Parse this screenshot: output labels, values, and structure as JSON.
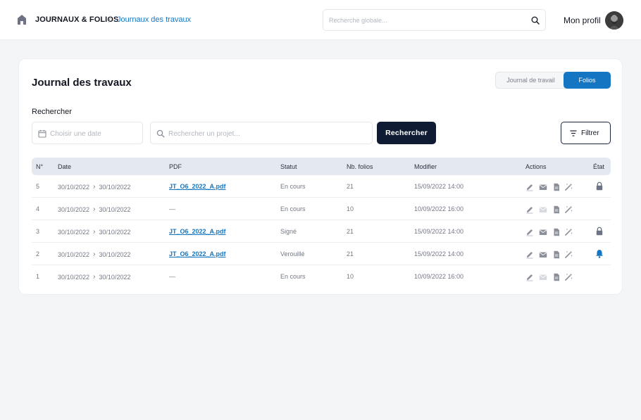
{
  "header": {
    "breadcrumb_root": "JOURNAUX  & FOLIOS",
    "breadcrumb_sep": "/",
    "breadcrumb_current": "Journaux des travaux",
    "search_placeholder": "Recherche globale...",
    "profile_label": "Mon profil"
  },
  "page": {
    "title": "Journal des travaux",
    "tabs": [
      {
        "label": "Journal de travail",
        "active": false
      },
      {
        "label": "Folios",
        "active": true
      }
    ]
  },
  "search": {
    "label": "Rechercher",
    "date_placeholder": "Choisir une date",
    "project_placeholder": "Rechercher un projet...",
    "search_button": "Rechercher",
    "filter_button": "Filtrer"
  },
  "table": {
    "columns": [
      "N°",
      "Date",
      "PDF",
      "Statut",
      "Nb. folios",
      "Modifier",
      "Actions",
      "État"
    ],
    "rows": [
      {
        "no": "5",
        "date_from": "30/10/2022",
        "date_to": "30/10/2022",
        "pdf": "JT_O6_2022_A.pdf",
        "statut": "En cours",
        "nb": "21",
        "modifier": "15/09/2022 14:00",
        "mail_active": true,
        "state": "lock-icon"
      },
      {
        "no": "4",
        "date_from": "30/10/2022",
        "date_to": "30/10/2022",
        "pdf": "—",
        "statut": "En cours",
        "nb": "10",
        "modifier": "10/09/2022 16:00",
        "mail_active": false,
        "state": ""
      },
      {
        "no": "3",
        "date_from": "30/10/2022",
        "date_to": "30/10/2022",
        "pdf": "JT_O6_2022_A.pdf",
        "statut": "Signé",
        "nb": "21",
        "modifier": "15/09/2022 14:00",
        "mail_active": true,
        "state": "lock-icon"
      },
      {
        "no": "2",
        "date_from": "30/10/2022",
        "date_to": "30/10/2022",
        "pdf": "JT_O6_2022_A.pdf",
        "statut": "Verouillé",
        "nb": "21",
        "modifier": "15/09/2022 14:00",
        "mail_active": true,
        "state": "bell-icon"
      },
      {
        "no": "1",
        "date_from": "30/10/2022",
        "date_to": "30/10/2022",
        "pdf": "—",
        "statut": "En cours",
        "nb": "10",
        "modifier": "10/09/2022 16:00",
        "mail_active": false,
        "state": ""
      }
    ]
  },
  "colors": {
    "accent": "#1476c2",
    "dark_button": "#0f1b33",
    "lock": "#6c7382",
    "bell": "#1476c2",
    "action_icon": "#8a8f9a",
    "action_icon_disabled": "#d6d9df"
  }
}
